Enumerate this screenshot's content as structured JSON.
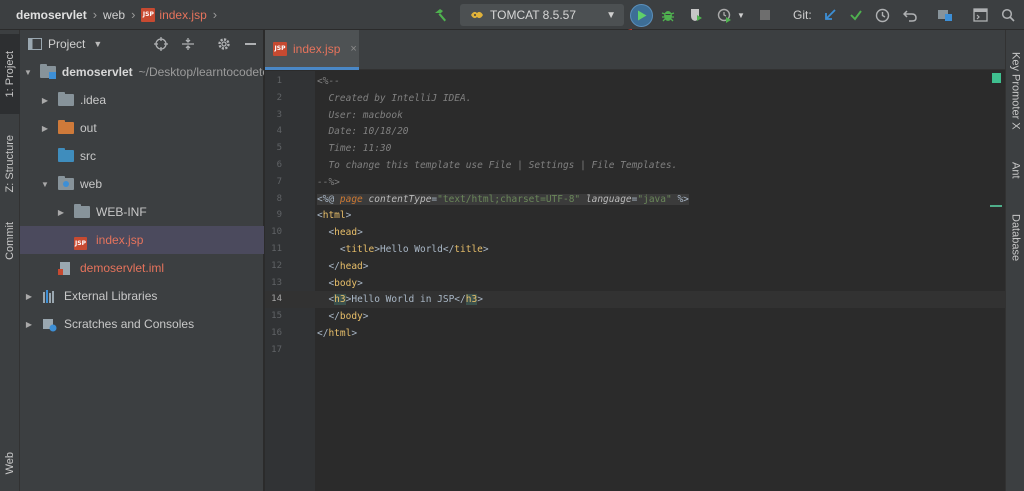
{
  "breadcrumb": {
    "project": "demoservlet",
    "folder": "web",
    "file": "index.jsp",
    "file_badge": "JSP"
  },
  "toolbar": {
    "run_config": "TOMCAT 8.5.57",
    "git_label": "Git:"
  },
  "left_strip": {
    "tabs": [
      "1: Project",
      "Z: Structure",
      "Commit",
      "Web"
    ]
  },
  "project_panel": {
    "title": "Project",
    "tree": [
      {
        "label": "demoservlet",
        "extra": "~/Desktop/learntocodetoge",
        "indent": 0,
        "expanded": true,
        "icon": "module-folder-icon"
      },
      {
        "label": ".idea",
        "indent": 1,
        "expanded": false,
        "icon": "folder-icon"
      },
      {
        "label": "out",
        "indent": 1,
        "expanded": false,
        "icon": "folder-orange-icon"
      },
      {
        "label": "src",
        "indent": 1,
        "expanded": null,
        "icon": "source-folder-icon"
      },
      {
        "label": "web",
        "indent": 1,
        "expanded": true,
        "icon": "web-folder-icon"
      },
      {
        "label": "WEB-INF",
        "indent": 2,
        "expanded": false,
        "icon": "folder-icon"
      },
      {
        "label": "index.jsp",
        "indent": 2,
        "expanded": null,
        "icon": "jsp-file-icon",
        "selected": true
      },
      {
        "label": "demoservlet.iml",
        "indent": 1,
        "expanded": null,
        "icon": "iml-file-icon"
      },
      {
        "label": "External Libraries",
        "indent": 0,
        "expanded": false,
        "icon": "libraries-icon"
      },
      {
        "label": "Scratches and Consoles",
        "indent": 0,
        "expanded": false,
        "icon": "scratches-icon"
      }
    ]
  },
  "editor": {
    "tab_label": "index.jsp",
    "tab_close": "×",
    "current_line": 14,
    "lines": [
      {
        "n": "1",
        "segments": [
          {
            "t": "<%--",
            "c": "cmt"
          }
        ]
      },
      {
        "n": "2",
        "segments": [
          {
            "t": "  Created by IntelliJ IDEA.",
            "c": "cmt"
          }
        ]
      },
      {
        "n": "3",
        "segments": [
          {
            "t": "  User: macbook",
            "c": "cmt"
          }
        ]
      },
      {
        "n": "4",
        "segments": [
          {
            "t": "  Date: 10/18/20",
            "c": "cmt"
          }
        ]
      },
      {
        "n": "5",
        "segments": [
          {
            "t": "  Time: 11:30",
            "c": "cmt"
          }
        ]
      },
      {
        "n": "6",
        "segments": [
          {
            "t": "  To change this template use File | Settings | File Templates.",
            "c": "cmt"
          }
        ]
      },
      {
        "n": "7",
        "segments": [
          {
            "t": "--%>",
            "c": "cmt"
          }
        ]
      },
      {
        "n": "8",
        "segments": [
          {
            "t": "<%@ ",
            "c": "txt dir"
          },
          {
            "t": "page ",
            "c": "kw dir"
          },
          {
            "t": "contentType",
            "c": "attr dir"
          },
          {
            "t": "=",
            "c": "txt dir"
          },
          {
            "t": "\"text/html;charset=UTF-8\"",
            "c": "str dir"
          },
          {
            "t": " ",
            "c": "txt dir"
          },
          {
            "t": "language",
            "c": "attr dir"
          },
          {
            "t": "=",
            "c": "txt dir"
          },
          {
            "t": "\"java\"",
            "c": "str dir"
          },
          {
            "t": " %>",
            "c": "txt dir"
          }
        ]
      },
      {
        "n": "9",
        "segments": [
          {
            "t": "<",
            "c": "txt"
          },
          {
            "t": "html",
            "c": "tag"
          },
          {
            "t": ">",
            "c": "txt"
          }
        ]
      },
      {
        "n": "10",
        "segments": [
          {
            "t": "  <",
            "c": "txt"
          },
          {
            "t": "head",
            "c": "tag"
          },
          {
            "t": ">",
            "c": "txt"
          }
        ]
      },
      {
        "n": "11",
        "segments": [
          {
            "t": "    <",
            "c": "txt"
          },
          {
            "t": "title",
            "c": "tag"
          },
          {
            "t": ">Hello World</",
            "c": "txt"
          },
          {
            "t": "title",
            "c": "tag"
          },
          {
            "t": ">",
            "c": "txt"
          }
        ]
      },
      {
        "n": "12",
        "segments": [
          {
            "t": "  </",
            "c": "txt"
          },
          {
            "t": "head",
            "c": "tag"
          },
          {
            "t": ">",
            "c": "txt"
          }
        ]
      },
      {
        "n": "13",
        "segments": [
          {
            "t": "  <",
            "c": "txt"
          },
          {
            "t": "body",
            "c": "tag"
          },
          {
            "t": ">",
            "c": "txt"
          }
        ]
      },
      {
        "n": "14",
        "segments": [
          {
            "t": "  <",
            "c": "txt"
          },
          {
            "t": "h3",
            "c": "tag hl"
          },
          {
            "t": ">Hello World in JSP</",
            "c": "txt"
          },
          {
            "t": "h3",
            "c": "tag hl"
          },
          {
            "t": ">",
            "c": "txt"
          }
        ]
      },
      {
        "n": "15",
        "segments": [
          {
            "t": "  </",
            "c": "txt"
          },
          {
            "t": "body",
            "c": "tag"
          },
          {
            "t": ">",
            "c": "txt"
          }
        ]
      },
      {
        "n": "16",
        "segments": [
          {
            "t": "</",
            "c": "txt"
          },
          {
            "t": "html",
            "c": "tag"
          },
          {
            "t": ">",
            "c": "txt"
          }
        ]
      },
      {
        "n": "17",
        "segments": []
      }
    ]
  },
  "right_strip": {
    "tabs": [
      "Key Promoter X",
      "Ant",
      "Database"
    ]
  },
  "colors": {
    "accent_blue": "#4a88c7",
    "jsp_red": "#e6735c",
    "run_green": "#4fb14f",
    "annotation_red": "#e0392b"
  }
}
